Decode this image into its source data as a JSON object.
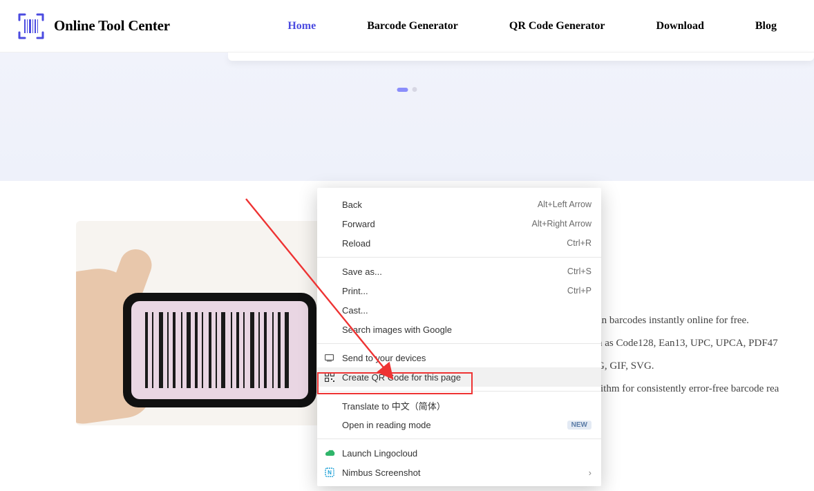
{
  "header": {
    "brand": "Online Tool Center",
    "nav": {
      "home": "Home",
      "barcode_gen": "Barcode Generator",
      "qr_gen": "QR Code Generator",
      "download": "Download",
      "blog": "Blog"
    }
  },
  "context_menu": {
    "back": {
      "label": "Back",
      "shortcut": "Alt+Left Arrow"
    },
    "forward": {
      "label": "Forward",
      "shortcut": "Alt+Right Arrow"
    },
    "reload": {
      "label": "Reload",
      "shortcut": "Ctrl+R"
    },
    "save_as": {
      "label": "Save as...",
      "shortcut": "Ctrl+S"
    },
    "print": {
      "label": "Print...",
      "shortcut": "Ctrl+P"
    },
    "cast": {
      "label": "Cast..."
    },
    "search_google": {
      "label": "Search images with Google"
    },
    "send_devices": {
      "label": "Send to your devices"
    },
    "create_qr": {
      "label": "Create QR Code for this page"
    },
    "translate": {
      "label": "Translate to 中文（简体）"
    },
    "reading_mode": {
      "label": "Open in reading mode",
      "badge": "NEW"
    },
    "lingocloud": {
      "label": "Launch Lingocloud"
    },
    "nimbus": {
      "label": "Nimbus Screenshot"
    }
  },
  "body_text": {
    "line1": "an barcodes instantly online for free.",
    "line2": "n as Code128, Ean13, UPC, UPCA, PDF47",
    "line3": "G, GIF, SVG.",
    "line4": "rithm for consistently error-free barcode rea"
  }
}
